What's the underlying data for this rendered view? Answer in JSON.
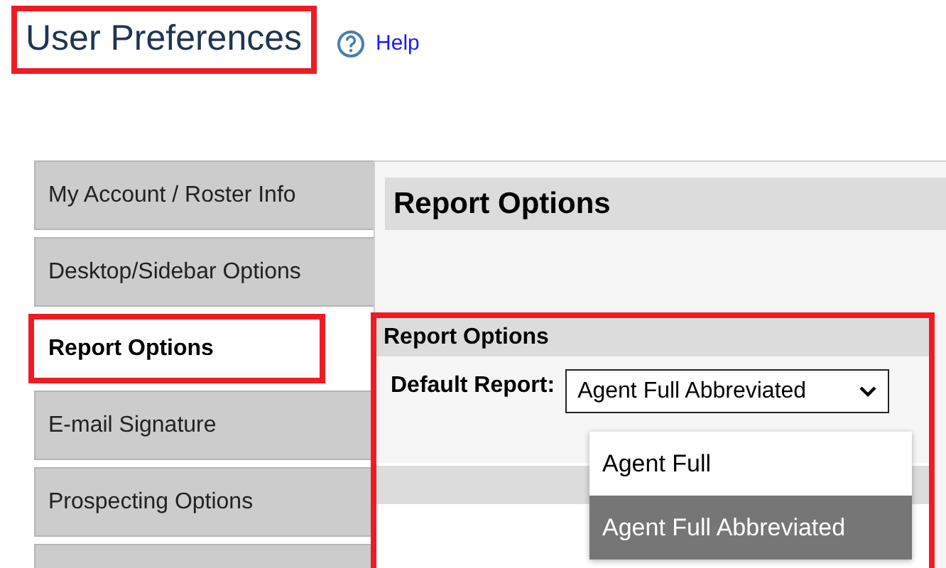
{
  "page_title": {
    "text": "User Preferences",
    "highlighted": true
  },
  "help_link": {
    "label": "Help"
  },
  "sidebar": {
    "items": [
      {
        "label": "My Account / Roster Info",
        "selected": false,
        "highlighted": false
      },
      {
        "label": "Desktop/Sidebar Options",
        "selected": false,
        "highlighted": false
      },
      {
        "label": "Report Options",
        "selected": true,
        "highlighted": true
      },
      {
        "label": "E-mail Signature",
        "selected": false,
        "highlighted": false
      },
      {
        "label": "Prospecting Options",
        "selected": false,
        "highlighted": false
      }
    ]
  },
  "main": {
    "heading": "Report Options",
    "section": {
      "title": "Report Options",
      "highlighted": true,
      "field": {
        "label": "Default Report:",
        "value": "Agent Full Abbreviated",
        "expanded": true,
        "options": [
          {
            "label": "Agent Full",
            "selected": false
          },
          {
            "label": "Agent Full Abbreviated",
            "selected": true
          }
        ]
      }
    }
  }
}
